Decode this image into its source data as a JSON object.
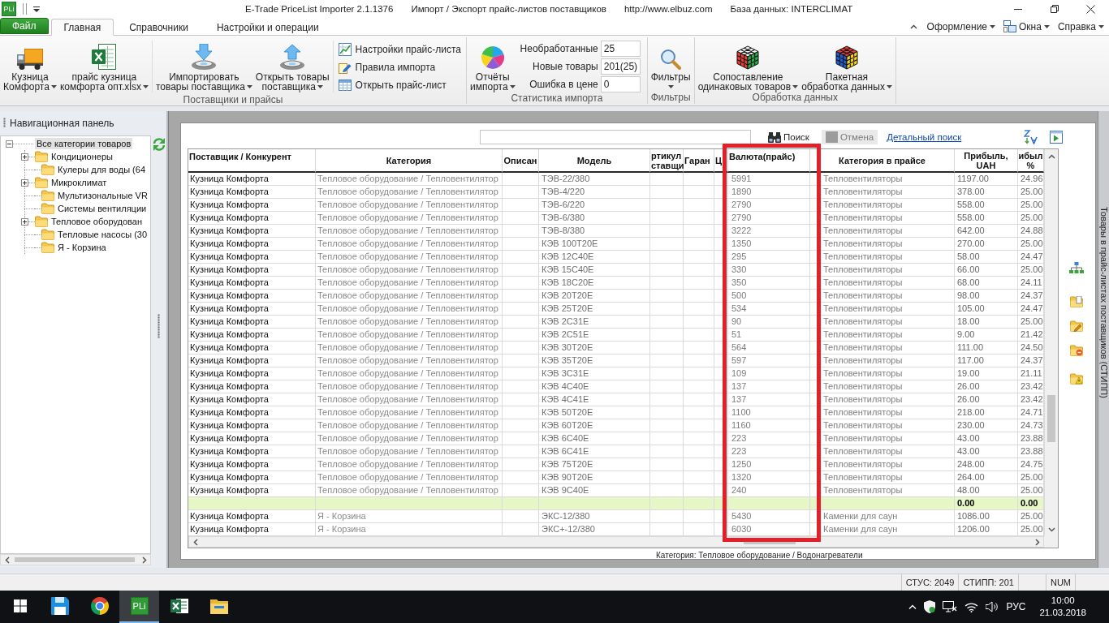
{
  "title_bar": {
    "badge": "PLi",
    "title_parts": [
      "E-Trade PriceList Importer 2.1.1376",
      "Импорт / Экспорт прайс-листов поставщиков",
      "http://www.elbuz.com",
      "База данных: INTERCLIMAT"
    ]
  },
  "menu": {
    "tabs": [
      {
        "label": "Файл",
        "kind": "file",
        "selected": false
      },
      {
        "label": "Главная",
        "kind": "tab",
        "selected": true
      },
      {
        "label": "Справочники",
        "kind": "tab",
        "selected": false
      },
      {
        "label": "Настройки и операции",
        "kind": "tab",
        "selected": false
      }
    ],
    "right_menus": [
      {
        "label": "Оформление",
        "kind": "plain"
      },
      {
        "label": "Окна",
        "kind": "windows"
      },
      {
        "label": "Справка",
        "kind": "plain"
      }
    ]
  },
  "ribbon": {
    "groups": [
      {
        "title": "Поставщики и прайсы",
        "sections": [
          {
            "kind": "large",
            "items": [
              {
                "lines": [
                  "Кузница",
                  "Комфорта"
                ],
                "dropdown": true
              },
              {
                "lines": [
                  "прайс кузница",
                  "комфорта опт.xlsx"
                ],
                "dropdown": true
              }
            ]
          },
          {
            "kind": "large",
            "items": [
              {
                "lines": [
                  "Импортировать",
                  "товары поставщика"
                ],
                "dropdown": true
              },
              {
                "lines": [
                  "Открыть товары",
                  "поставщика"
                ],
                "dropdown": true
              }
            ]
          },
          {
            "kind": "small",
            "items": [
              {
                "label": "Настройки прайс-листа"
              },
              {
                "label": "Правила импорта"
              },
              {
                "label": "Открыть прайс-лист"
              }
            ]
          }
        ]
      },
      {
        "title": "Статистика импорта",
        "sections": [
          {
            "kind": "stats",
            "button": {
              "lines": [
                "Отчёты",
                "импорта"
              ],
              "dropdown": true
            },
            "counters": [
              {
                "label": "Необработанные",
                "value": "25"
              },
              {
                "label": "Новые товары",
                "value": "201(25)"
              },
              {
                "label": "Ошибка в цене",
                "value": "0"
              }
            ]
          }
        ]
      },
      {
        "title": "Фильтры",
        "sections": [
          {
            "kind": "large",
            "items": [
              {
                "lines": [
                  "Фильтры"
                ],
                "dropdown": true
              }
            ]
          }
        ]
      },
      {
        "title": "Обработка данных",
        "sections": [
          {
            "kind": "large",
            "items": [
              {
                "lines": [
                  "Сопоставление",
                  "одинаковых товаров"
                ],
                "dropdown": true
              },
              {
                "lines": [
                  "Пакетная",
                  "обработка данных"
                ],
                "dropdown": true
              }
            ]
          }
        ]
      }
    ]
  },
  "nav_panel": {
    "title": "Навигационная панель",
    "tree": {
      "label": "Все категории товаров",
      "expanded": true,
      "selected": true,
      "children": [
        {
          "label": "Кондиционеры",
          "expanded": false,
          "selected": false
        },
        {
          "label": "Кулеры для воды (64",
          "selected": false
        },
        {
          "label": "Микроклимат",
          "expanded": false,
          "selected": false
        },
        {
          "label": "Мультизональные VR",
          "selected": false
        },
        {
          "label": "Системы вентиляции",
          "selected": false
        },
        {
          "label": "Тепловое оборудован",
          "expanded": false,
          "selected": false
        },
        {
          "label": "Тепловые насосы (30",
          "selected": false
        },
        {
          "label": "Я - Корзина",
          "selected": false
        }
      ]
    }
  },
  "search": {
    "buttons": [
      {
        "label": "Поиск",
        "kind": "search"
      },
      {
        "label": "Отмена",
        "kind": "cancel"
      }
    ],
    "link": "Детальный поиск"
  },
  "table": {
    "columns": [
      {
        "lines": [
          "Поставщик / Конкурент"
        ]
      },
      {
        "lines": [
          "Категория"
        ]
      },
      {
        "lines": [
          "Описан"
        ]
      },
      {
        "lines": [
          "Модель"
        ]
      },
      {
        "lines": [
          "ртикул",
          "ставщи"
        ]
      },
      {
        "lines": [
          "Гаран"
        ]
      },
      {
        "lines": [
          "Ц"
        ]
      },
      {
        "lines": [
          "Валюта(прайс)"
        ]
      },
      {
        "lines": [
          "Категория в прайсе"
        ]
      },
      {
        "lines": [
          "Прибыль,",
          "UAH"
        ]
      },
      {
        "lines": [
          "ибыл",
          "%"
        ]
      }
    ],
    "rows": [
      {
        "kind": "item",
        "supplier": "Кузница Комфорта",
        "category": "Тепловое оборудование / Тепловентилятор",
        "model": "ТЭВ-22/380",
        "price": "5991",
        "price_category": "Тепловентиляторы",
        "profit_uah": "1197.00",
        "profit_pct": "24.96"
      },
      {
        "kind": "item",
        "supplier": "Кузница Комфорта",
        "category": "Тепловое оборудование / Тепловентилятор",
        "model": "ТЭВ-4/220",
        "price": "1890",
        "price_category": "Тепловентиляторы",
        "profit_uah": "378.00",
        "profit_pct": "25.00"
      },
      {
        "kind": "item",
        "supplier": "Кузница Комфорта",
        "category": "Тепловое оборудование / Тепловентилятор",
        "model": "ТЭВ-6/220",
        "price": "2790",
        "price_category": "Тепловентиляторы",
        "profit_uah": "558.00",
        "profit_pct": "25.00"
      },
      {
        "kind": "item",
        "supplier": "Кузница Комфорта",
        "category": "Тепловое оборудование / Тепловентилятор",
        "model": "ТЭВ-6/380",
        "price": "2790",
        "price_category": "Тепловентиляторы",
        "profit_uah": "558.00",
        "profit_pct": "25.00"
      },
      {
        "kind": "item",
        "supplier": "Кузница Комфорта",
        "category": "Тепловое оборудование / Тепловентилятор",
        "model": "ТЭВ-8/380",
        "price": "3222",
        "price_category": "Тепловентиляторы",
        "profit_uah": "642.00",
        "profit_pct": "24.88"
      },
      {
        "kind": "item",
        "supplier": "Кузница Комфорта",
        "category": "Тепловое оборудование / Тепловентилятор",
        "model": "КЭВ 100Т20Е",
        "price": "1350",
        "price_category": "Тепловентиляторы",
        "profit_uah": "270.00",
        "profit_pct": "25.00"
      },
      {
        "kind": "item",
        "supplier": "Кузница Комфорта",
        "category": "Тепловое оборудование / Тепловентилятор",
        "model": "КЭВ 12С40Е",
        "price": "295",
        "price_category": "Тепловентиляторы",
        "profit_uah": "58.00",
        "profit_pct": "24.47"
      },
      {
        "kind": "item",
        "supplier": "Кузница Комфорта",
        "category": "Тепловое оборудование / Тепловентилятор",
        "model": "КЭВ 15С40Е",
        "price": "330",
        "price_category": "Тепловентиляторы",
        "profit_uah": "66.00",
        "profit_pct": "25.00"
      },
      {
        "kind": "item",
        "supplier": "Кузница Комфорта",
        "category": "Тепловое оборудование / Тепловентилятор",
        "model": "КЭВ 18С20Е",
        "price": "350",
        "price_category": "Тепловентиляторы",
        "profit_uah": "68.00",
        "profit_pct": "24.11"
      },
      {
        "kind": "item",
        "supplier": "Кузница Комфорта",
        "category": "Тепловое оборудование / Тепловентилятор",
        "model": "КЭВ 20Т20Е",
        "price": "500",
        "price_category": "Тепловентиляторы",
        "profit_uah": "98.00",
        "profit_pct": "24.37"
      },
      {
        "kind": "item",
        "supplier": "Кузница Комфорта",
        "category": "Тепловое оборудование / Тепловентилятор",
        "model": "КЭВ 25Т20Е",
        "price": "534",
        "price_category": "Тепловентиляторы",
        "profit_uah": "105.00",
        "profit_pct": "24.47"
      },
      {
        "kind": "item",
        "supplier": "Кузница Комфорта",
        "category": "Тепловое оборудование / Тепловентилятор",
        "model": "КЭВ 2С31Е",
        "price": "90",
        "price_category": "Тепловентиляторы",
        "profit_uah": "18.00",
        "profit_pct": "25.00"
      },
      {
        "kind": "item",
        "supplier": "Кузница Комфорта",
        "category": "Тепловое оборудование / Тепловентилятор",
        "model": "КЭВ 2С51Е",
        "price": "51",
        "price_category": "Тепловентиляторы",
        "profit_uah": "9.00",
        "profit_pct": "21.42"
      },
      {
        "kind": "item",
        "supplier": "Кузница Комфорта",
        "category": "Тепловое оборудование / Тепловентилятор",
        "model": "КЭВ 30Т20Е",
        "price": "564",
        "price_category": "Тепловентиляторы",
        "profit_uah": "111.00",
        "profit_pct": "24.50"
      },
      {
        "kind": "item",
        "supplier": "Кузница Комфорта",
        "category": "Тепловое оборудование / Тепловентилятор",
        "model": "КЭВ 35Т20Е",
        "price": "597",
        "price_category": "Тепловентиляторы",
        "profit_uah": "117.00",
        "profit_pct": "24.37"
      },
      {
        "kind": "item",
        "supplier": "Кузница Комфорта",
        "category": "Тепловое оборудование / Тепловентилятор",
        "model": "КЭВ 3С31Е",
        "price": "109",
        "price_category": "Тепловентиляторы",
        "profit_uah": "19.00",
        "profit_pct": "21.11"
      },
      {
        "kind": "item",
        "supplier": "Кузница Комфорта",
        "category": "Тепловое оборудование / Тепловентилятор",
        "model": "КЭВ 4С40Е",
        "price": "137",
        "price_category": "Тепловентиляторы",
        "profit_uah": "26.00",
        "profit_pct": "23.42"
      },
      {
        "kind": "item",
        "supplier": "Кузница Комфорта",
        "category": "Тепловое оборудование / Тепловентилятор",
        "model": "КЭВ 4С41Е",
        "price": "137",
        "price_category": "Тепловентиляторы",
        "profit_uah": "26.00",
        "profit_pct": "23.42"
      },
      {
        "kind": "item",
        "supplier": "Кузница Комфорта",
        "category": "Тепловое оборудование / Тепловентилятор",
        "model": "КЭВ 50Т20Е",
        "price": "1100",
        "price_category": "Тепловентиляторы",
        "profit_uah": "218.00",
        "profit_pct": "24.71"
      },
      {
        "kind": "item",
        "supplier": "Кузница Комфорта",
        "category": "Тепловое оборудование / Тепловентилятор",
        "model": "КЭВ 60Т20Е",
        "price": "1160",
        "price_category": "Тепловентиляторы",
        "profit_uah": "230.00",
        "profit_pct": "24.73"
      },
      {
        "kind": "item",
        "supplier": "Кузница Комфорта",
        "category": "Тепловое оборудование / Тепловентилятор",
        "model": "КЭВ 6С40Е",
        "price": "223",
        "price_category": "Тепловентиляторы",
        "profit_uah": "43.00",
        "profit_pct": "23.88"
      },
      {
        "kind": "item",
        "supplier": "Кузница Комфорта",
        "category": "Тепловое оборудование / Тепловентилятор",
        "model": "КЭВ 6С41Е",
        "price": "223",
        "price_category": "Тепловентиляторы",
        "profit_uah": "43.00",
        "profit_pct": "23.88"
      },
      {
        "kind": "item",
        "supplier": "Кузница Комфорта",
        "category": "Тепловое оборудование / Тепловентилятор",
        "model": "КЭВ 75Т20Е",
        "price": "1250",
        "price_category": "Тепловентиляторы",
        "profit_uah": "248.00",
        "profit_pct": "24.75"
      },
      {
        "kind": "item",
        "supplier": "Кузница Комфорта",
        "category": "Тепловое оборудование / Тепловентилятор",
        "model": "КЭВ 90Т20Е",
        "price": "1320",
        "price_category": "Тепловентиляторы",
        "profit_uah": "264.00",
        "profit_pct": "25.00"
      },
      {
        "kind": "item",
        "supplier": "Кузница Комфорта",
        "category": "Тепловое оборудование / Тепловентилятор",
        "model": "КЭВ 9С40Е",
        "price": "240",
        "price_category": "Тепловентиляторы",
        "profit_uah": "48.00",
        "profit_pct": "25.00"
      },
      {
        "kind": "total",
        "profit_uah": "0.00",
        "profit_pct": "0.00"
      },
      {
        "kind": "item",
        "supplier": "Кузница Комфорта",
        "category": "Я - Корзина",
        "model": "ЭКС-12/380",
        "price": "5430",
        "price_category": "Каменки для саун",
        "profit_uah": "1086.00",
        "profit_pct": "25.00"
      },
      {
        "kind": "item",
        "supplier": "Кузница Комфорта",
        "category": "Я - Корзина",
        "model": "ЭКС+-12/380",
        "price": "6030",
        "price_category": "Каменки для саун",
        "profit_uah": "1206.00",
        "profit_pct": "25.00"
      }
    ]
  },
  "category_caption": "Категория: Тепловое оборудование / Водонагреватели",
  "side_tab": "Товары в прайс-листах поставщиков (СТИПП)",
  "status_bar": {
    "items": [
      "СТУС: 2049",
      "СТИПП: 201",
      "NUM"
    ]
  },
  "taskbar": {
    "apps": [
      {
        "selected": false
      },
      {
        "selected": false
      },
      {
        "selected": true,
        "badge": "PLi"
      },
      {
        "selected": false
      },
      {
        "selected": false
      }
    ],
    "tray": {
      "language": "РУС",
      "time": "10:00",
      "date": "21.03.2018"
    }
  }
}
